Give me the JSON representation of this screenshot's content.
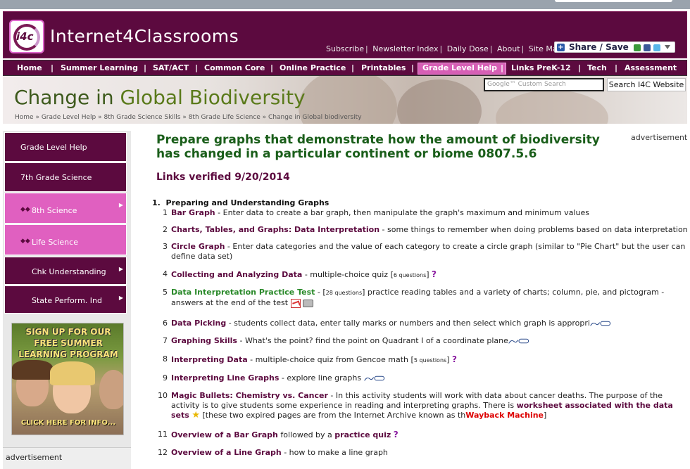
{
  "header": {
    "logo_text": "i4c",
    "site_name": "Internet4Classrooms",
    "links": [
      "Subscribe",
      "Newsletter Index",
      "Daily Dose",
      "About",
      "Site Map"
    ],
    "share_label": "Share / Save"
  },
  "nav": {
    "items": [
      "Home",
      "Summer Learning",
      "SAT/ACT",
      "Common Core",
      "Online Practice",
      "Printables",
      "Grade Level Help",
      "Links PreK-12",
      "Tech",
      "Assessment"
    ],
    "active": "Grade Level Help"
  },
  "banner": {
    "title_part1": "Change in ",
    "title_part2": "Global Biodiversity",
    "breadcrumb": [
      "Home",
      "Grade Level Help",
      "8th Grade Science Skills",
      "8th Grade Life Science",
      "Change in Global biodiversity"
    ],
    "breadcrumb_sep": " » ",
    "search_placeholder": "Google™ Custom Search",
    "search_button": "Search I4C Website"
  },
  "sidebar": {
    "items": [
      {
        "label": "Grade Level Help",
        "style": "dark",
        "arrow": false
      },
      {
        "label": "7th Grade Science",
        "style": "dark",
        "arrow": false
      },
      {
        "label": "8th Science",
        "style": "pink",
        "arrow": true
      },
      {
        "label": "Life Science",
        "style": "pink",
        "arrow": false
      },
      {
        "label": "Chk Understanding",
        "style": "dark",
        "arrow": true
      },
      {
        "label": "State Perform. Ind",
        "style": "dark",
        "arrow": true
      }
    ],
    "promo_lines": [
      "SIGN UP FOR OUR",
      "FREE SUMMER",
      "LEARNING PROGRAM"
    ],
    "promo_cta": "CLICK HERE FOR INFO...",
    "ad_label": "advertisement"
  },
  "main": {
    "ad_label": "advertisement",
    "title": "Prepare graphs that demonstrate how the amount of biodiversity has changed in a particular continent or biome 0807.5.6",
    "verified": "Links verified 9/20/2014",
    "section_num": "1.",
    "section_title": "Preparing and Understanding Graphs",
    "resources": [
      {
        "num": "1",
        "title": "Bar Graph",
        "desc": " - Enter data to create a bar graph, then manipulate the graph's maximum and minimum values"
      },
      {
        "num": "2",
        "title": "Charts, Tables, and Graphs: Data Interpretation",
        "desc": "  - some things to remember when doing problems based on data interpretation"
      },
      {
        "num": "3",
        "title": "Circle Graph",
        "desc": " - Enter data categories and the value of each category to create a circle graph (similar to \"Pie Chart\" but the user can define data set)"
      },
      {
        "num": "4",
        "title": "Collecting and Analyzing Data",
        "desc": "  - multiple-choice quiz [",
        "small": "6 questions",
        "desc2": "]"
      },
      {
        "num": "5",
        "title": "Data Interpretation Practice Test",
        "desc": "  - [",
        "small": "28 questions",
        "desc2": "] practice reading tables and a variety of charts; column, pie, and pictogram - answers at the end of the test"
      },
      {
        "num": "6",
        "title": "Data Picking",
        "desc": "  - students collect data, enter tally marks or numbers and then select which graph is appropri"
      },
      {
        "num": "7",
        "title": "Graphing Skills",
        "desc": "  - What's the point? find the point on Quadrant I of a coordinate plane"
      },
      {
        "num": "8",
        "title": "Interpreting Data",
        "desc": "  - multiple-choice quiz from Gencoe math [",
        "small": "5 questions",
        "desc2": "]"
      },
      {
        "num": "9",
        "title": "Interpreting Line Graphs",
        "desc": "  - explore line graphs "
      },
      {
        "num": "10",
        "title": "Magic Bullets: Chemistry vs. Cancer",
        "desc": "  - In this activity students will work with data about cancer deaths. The purpose of the activity is to give students some experience in reading and interpreting graphs. There is ",
        "link2": "worksheet associated with the data sets",
        "desc2": " [these two expired pages are from the Internet Archive known as th",
        "link3": "Wayback Machine",
        "desc3": "]"
      },
      {
        "num": "11",
        "title": "Overview of a Bar Graph",
        "desc": " followed by a ",
        "link2": "practice quiz"
      },
      {
        "num": "12",
        "title": "Overview of a Line Graph",
        "desc": " - how to make a line graph"
      }
    ]
  },
  "colors": {
    "brand": "#5c0a3f",
    "pink": "#d65fb5",
    "title_green": "#1a5e1a"
  }
}
